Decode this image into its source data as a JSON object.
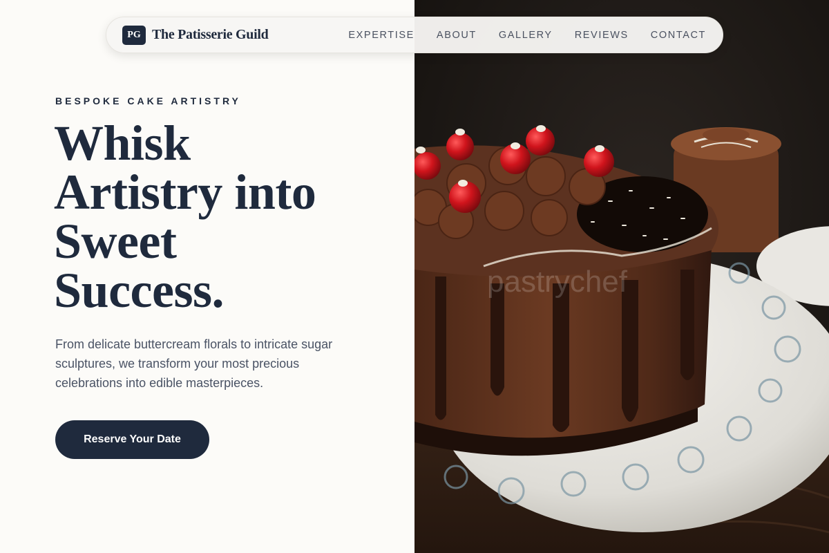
{
  "brand": {
    "logo_initials": "PG",
    "name": "The Patisserie Guild"
  },
  "nav": {
    "items": [
      {
        "label": "EXPERTISE"
      },
      {
        "label": "ABOUT"
      },
      {
        "label": "GALLERY"
      },
      {
        "label": "REVIEWS"
      },
      {
        "label": "CONTACT"
      }
    ]
  },
  "hero": {
    "eyebrow": "BESPOKE CAKE ARTISTRY",
    "headline_lines": [
      "Whisk",
      "Artistry into",
      "Sweet",
      "Success."
    ],
    "description_lines": [
      "From delicate buttercream florals to intricate sugar",
      "sculptures, we transform your most precious",
      "celebrations into edible masterpieces."
    ],
    "cta_label": "Reserve Your Date"
  },
  "image": {
    "subject": "chocolate cake with cherries and chocolate sprinkles on a decorated white plate",
    "watermark": "pastrychef"
  },
  "colors": {
    "primary_navy": "#1f2a3d",
    "background_cream": "#fcfbf8",
    "body_text": "#4a5365",
    "nav_text": "#4a5160"
  }
}
